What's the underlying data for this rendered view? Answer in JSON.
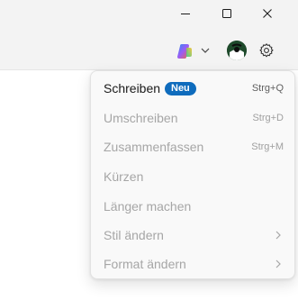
{
  "window_controls": {
    "minimize": "minimize-icon",
    "maximize": "maximize-icon",
    "close": "close-icon"
  },
  "toolbar": {
    "icons": [
      "copilot-icon",
      "chevron-down-icon",
      "profile-avatar",
      "gear-icon"
    ]
  },
  "menu": {
    "items": [
      {
        "label": "Schreiben",
        "badge": "Neu",
        "shortcut": "Strg+Q",
        "enabled": true
      },
      {
        "label": "Umschreiben",
        "shortcut": "Strg+D",
        "enabled": false
      },
      {
        "label": "Zusammenfassen",
        "shortcut": "Strg+M",
        "enabled": false
      },
      {
        "label": "Kürzen",
        "enabled": false
      },
      {
        "label": "Länger machen",
        "enabled": false
      },
      {
        "label": "Stil ändern",
        "submenu": true,
        "enabled": false
      },
      {
        "label": "Format ändern",
        "submenu": true,
        "enabled": false
      }
    ]
  },
  "colors": {
    "badge": "#0f6cbd",
    "disabled_text": "#a6a6a6",
    "menu_bg": "#f9f9f9"
  }
}
